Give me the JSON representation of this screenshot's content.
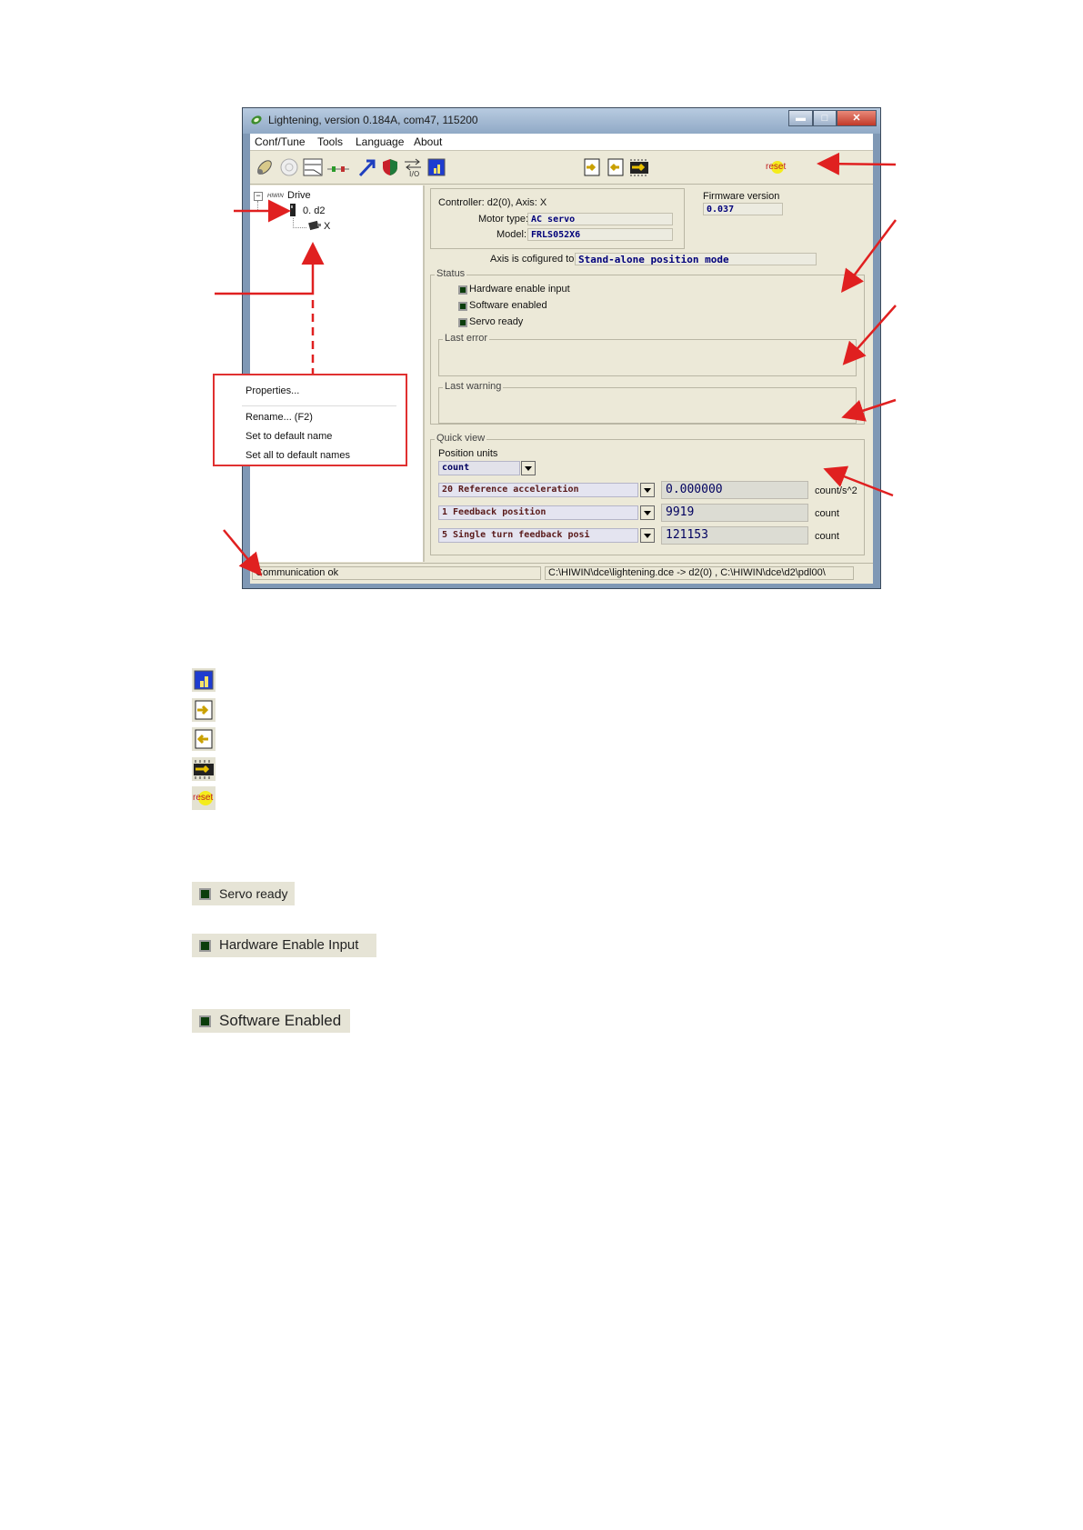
{
  "window": {
    "title": "Lightening, version 0.184A, com47, 115200",
    "controls": {
      "minimize": "▬",
      "maximize": "□",
      "close": "✕"
    }
  },
  "menu": {
    "items": [
      "Conf/Tune",
      "Tools",
      "Language",
      "About"
    ]
  },
  "toolbar": {
    "icons": [
      "configure-motor-icon",
      "tuning-dial-icon",
      "chart-icon",
      "io-icon",
      "arrow-icon",
      "shield-icon",
      "io-transfer-icon",
      "blue-chart-icon",
      "load-to-drive-icon",
      "save-from-drive-icon",
      "flash-memory-icon"
    ],
    "reset_label": "reset"
  },
  "tree": {
    "root_logo": "HIWIN",
    "root": "Drive",
    "drive": "0. d2",
    "axis": "X"
  },
  "controller_info": {
    "controller_label": "Controller: d2(0), Axis: X",
    "motor_type_label": "Motor type:",
    "motor_type_value": "AC servo",
    "model_label": "Model:",
    "model_value": "FRLS052X6",
    "firmware_label": "Firmware version",
    "firmware_value": "0.037",
    "configured_label": "Axis is cofigured to:",
    "configured_value": "Stand-alone position mode"
  },
  "status": {
    "group_label": "Status",
    "items": [
      "Hardware enable input",
      "Software enabled",
      "Servo ready"
    ],
    "last_error_label": "Last error",
    "last_warning_label": "Last warning"
  },
  "quick_view": {
    "group_label": "Quick view",
    "position_units_label": "Position units",
    "position_units_value": "count",
    "rows": [
      {
        "variable": "20 Reference acceleration",
        "value": "0.000000",
        "unit": "count/s^2"
      },
      {
        "variable": " 1 Feedback position",
        "value": "9919",
        "unit": "count"
      },
      {
        "variable": " 5 Single turn feedback posi",
        "value": "121153",
        "unit": "count"
      }
    ]
  },
  "statusbar": {
    "left": "Communication ok",
    "right": "C:\\HIWIN\\dce\\lightening.dce -> d2(0) , C:\\HIWIN\\dce\\d2\\pdl00\\"
  },
  "context_menu": {
    "items": [
      "Properties...",
      "Rename... (F2)",
      "Set to default name",
      "Set all to default names"
    ]
  },
  "legend": {
    "reset_label": "reset",
    "badges": [
      "Servo ready",
      "Hardware Enable Input",
      "Software Enabled"
    ]
  },
  "colors": {
    "annotation": "#e02020",
    "led": "#0b3d0b",
    "window_bg": "#ece9d8"
  }
}
